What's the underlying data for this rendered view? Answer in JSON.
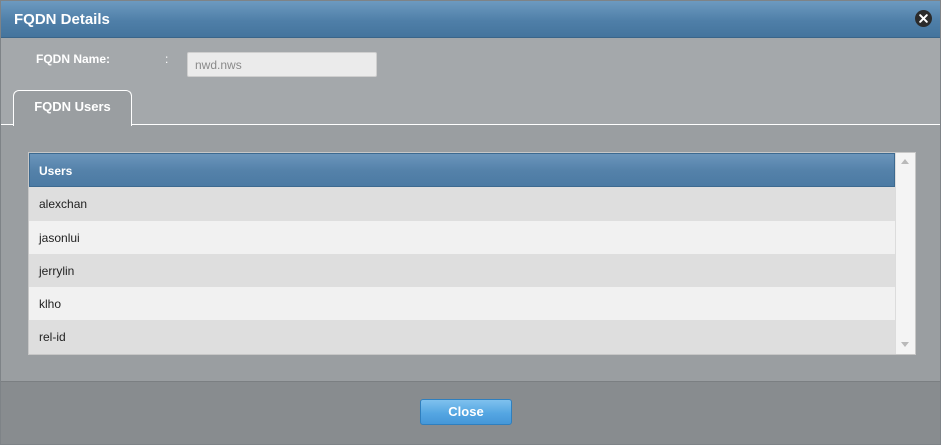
{
  "dialog": {
    "title": "FQDN Details",
    "close_icon": "close-icon"
  },
  "form": {
    "fqdn_name_label": "FQDN Name:",
    "separator": ":",
    "fqdn_name_value": "nwd.nws"
  },
  "tabs": [
    {
      "label": "FQDN Users",
      "active": true
    }
  ],
  "users_table": {
    "column_header": "Users",
    "rows": [
      "alexchan",
      "jasonlui",
      "jerrylin",
      "klho",
      "rel-id"
    ]
  },
  "footer": {
    "close_label": "Close"
  },
  "colors": {
    "title_bar": "#4f7fa8",
    "header_row": "#5582aa",
    "close_button": "#55a6e2",
    "alt_row": "#dedede"
  }
}
